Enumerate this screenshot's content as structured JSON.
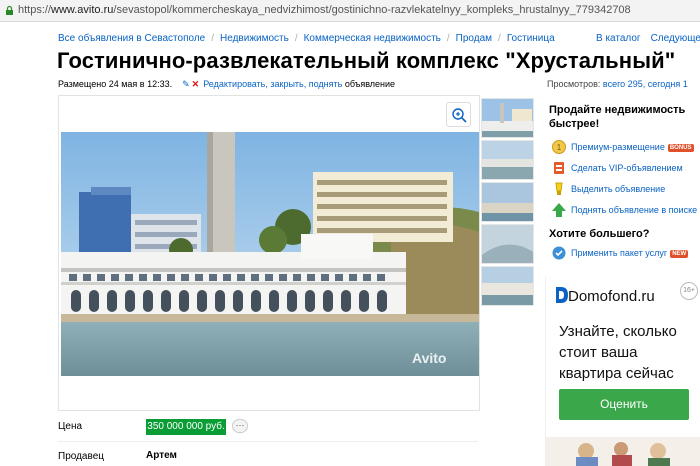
{
  "browser": {
    "url_scheme": "https://",
    "url_host": "www.avito.ru",
    "url_path": "/sevastopol/kommercheskaya_nedvizhimost/gostinichno-razvlekatelnyy_kompleks_hrustalnyy_779342708"
  },
  "breadcrumbs": [
    "Все объявления в Севастополе",
    "Недвижимость",
    "Коммерческая недвижимость",
    "Продам",
    "Гостиница"
  ],
  "nav": {
    "catalog": "В каталог",
    "next": "Следующее →"
  },
  "listing": {
    "title": "Гостинично-развлекательный комплекс \"Хрустальный\"",
    "posted": "Размещено 24 мая в 12:33.",
    "actions": "Редактировать, закрыть, поднять",
    "actions_suffix": "объявление",
    "views_label": "Просмотров:",
    "views_value": "всего 295, сегодня 1",
    "watermark": "Avito"
  },
  "details": {
    "price_label": "Цена",
    "price_value": "350 000 000 руб.",
    "more_label": "···",
    "seller_label": "Продавец",
    "seller_value": "Артем"
  },
  "promo": {
    "heading": "Продайте недвижимость быстрее!",
    "items": [
      {
        "label": "Премиум-размещение",
        "badge": "BONUS",
        "icon": "coin-icon"
      },
      {
        "label": "Сделать VIP-объявлением",
        "badge": "",
        "icon": "vip-icon"
      },
      {
        "label": "Выделить объявление",
        "badge": "",
        "icon": "highlight-icon"
      },
      {
        "label": "Поднять объявление в поиске",
        "badge": "",
        "icon": "arrow-up-icon"
      }
    ],
    "more_heading": "Хотите большего?",
    "package": {
      "label": "Применить пакет услуг",
      "badge": "NEW"
    }
  },
  "ad": {
    "brand": "Domofond.ru",
    "age": "16+",
    "copy": "Узнайте, сколько стоит ваша квартира сейчас",
    "button": "Оценить"
  },
  "colors": {
    "link": "#0a63c4",
    "price_bg": "#0a9d35",
    "ad_button": "#3aa84a"
  }
}
